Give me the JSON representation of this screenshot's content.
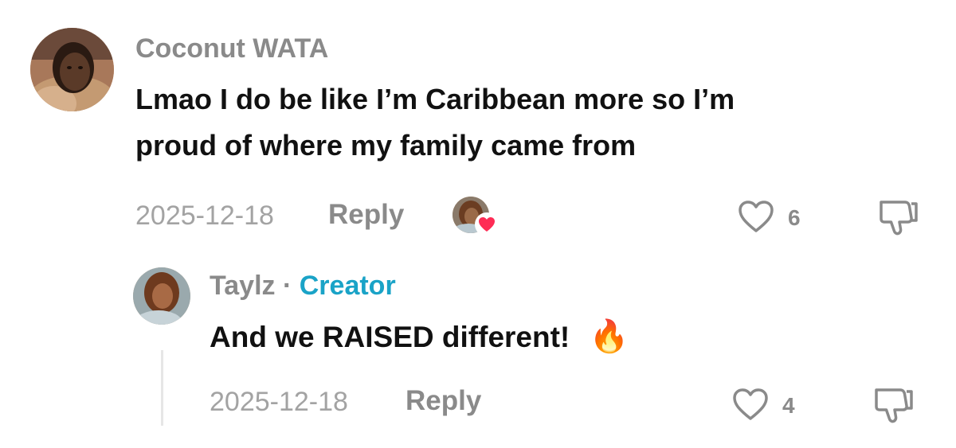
{
  "comments": [
    {
      "username": "Coconut WATA",
      "text_line1": "Lmao I do be like I’m Caribbean more so I’m",
      "text_line2": "proud of where my family came from",
      "date": "2025-12-18",
      "reply_label": "Reply",
      "likes": "6",
      "liked_by_creator": true
    }
  ],
  "replies": [
    {
      "username": "Taylz",
      "separator": "·",
      "badge": "Creator",
      "text": "And we RAISED different!",
      "emoji": "🔥",
      "date": "2025-12-18",
      "reply_label": "Reply",
      "likes": "4"
    }
  ],
  "icons": {
    "like": "heart-outline-icon",
    "dislike": "thumbs-down-icon",
    "creator_liked": "creator-liked-heart-icon"
  },
  "colors": {
    "creator_badge": "#1aa3c7",
    "heart_badge": "#fe2c55",
    "username": "#8a8a8a",
    "text": "#111111"
  }
}
